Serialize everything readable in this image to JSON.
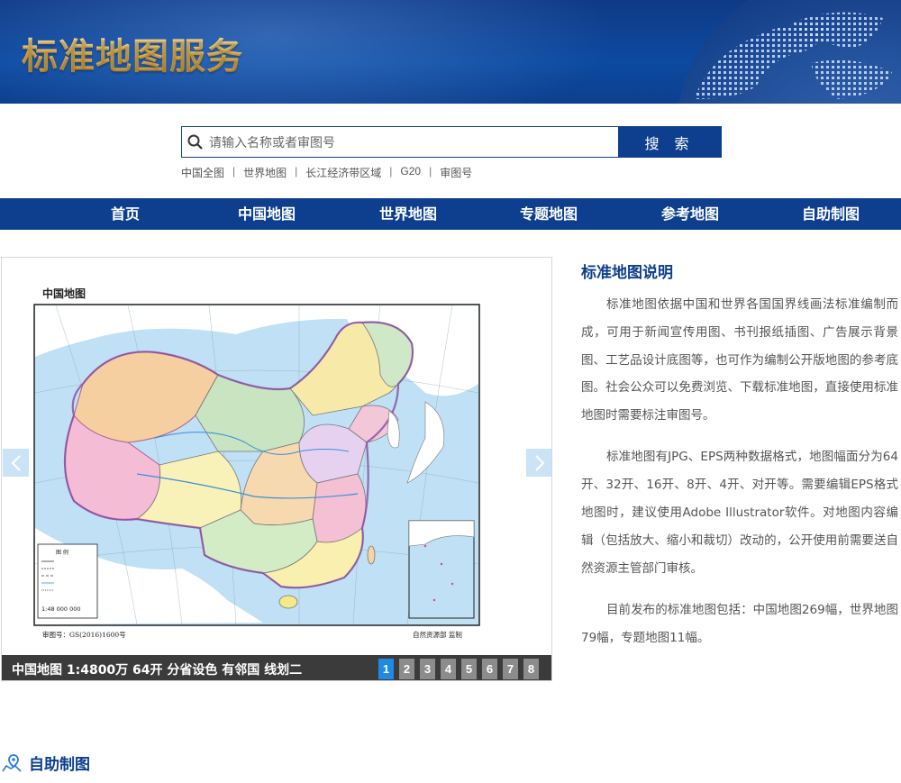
{
  "banner": {
    "title": "标准地图服务"
  },
  "search": {
    "placeholder": "请输入名称或者审图号",
    "button_label": "搜 索",
    "quick_links": [
      "中国全图",
      "世界地图",
      "长江经济带区域",
      "G20",
      "审图号"
    ]
  },
  "nav": {
    "items": [
      "首页",
      "中国地图",
      "世界地图",
      "专题地图",
      "参考地图",
      "自助制图"
    ]
  },
  "slider": {
    "map_title": "中国地图",
    "approval_no": "审图号：GS(2016)1600号",
    "supervisor": "自然资源部 监制",
    "scale_text": "1:48 000 000",
    "legend_title": "图 例",
    "caption": "中国地图 1:4800万 64开 分省设色 有邻国 线划二",
    "pages": [
      "1",
      "2",
      "3",
      "4",
      "5",
      "6",
      "7",
      "8"
    ],
    "active_page": "1"
  },
  "description": {
    "title": "标准地图说明",
    "paragraphs": [
      "标准地图依据中国和世界各国国界线画法标准编制而成，可用于新闻宣传用图、书刊报纸插图、广告展示背景图、工艺品设计底图等，也可作为编制公开版地图的参考底图。社会公众可以免费浏览、下载标准地图，直接使用标准地图时需要标注审图号。",
      "标准地图有JPG、EPS两种数据格式，地图幅面分为64开、32开、16开、8开、4开、对开等。需要编辑EPS格式地图时，建议使用Adobe Illustrator软件。对地图内容编辑（包括放大、缩小和裁切）改动的，公开使用前需要送自然资源主管部门审核。",
      "目前发布的标准地图包括：中国地图269幅，世界地图79幅，专题地图11幅。"
    ]
  },
  "section": {
    "title": "自助制图"
  },
  "colors": {
    "brand_blue": "#0d3f8e",
    "active_page": "#1e8ae6",
    "banner_title_gold": "#f3c25a"
  }
}
